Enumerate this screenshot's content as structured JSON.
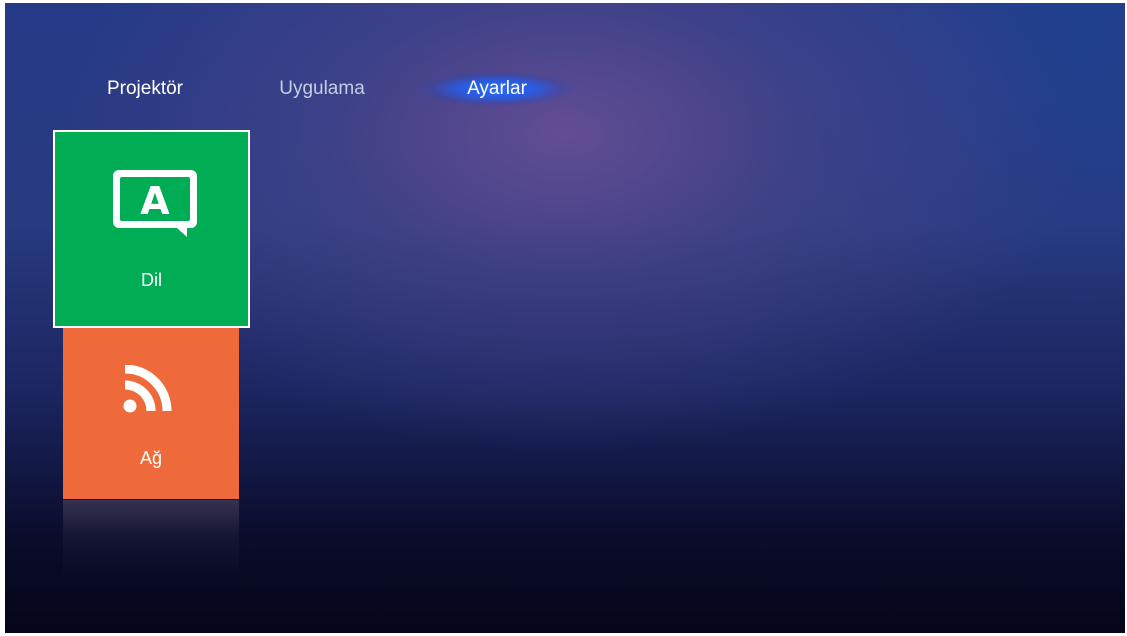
{
  "tabs": [
    {
      "label": "Projektör",
      "active": false
    },
    {
      "label": "Uygulama",
      "active": false
    },
    {
      "label": "Ayarlar",
      "active": true
    }
  ],
  "tiles": [
    {
      "label": "Dil",
      "icon": "language-icon",
      "color": "#00ad55",
      "selected": true
    },
    {
      "label": "Ağ",
      "icon": "network-feed-icon",
      "color": "#ef6a3a",
      "selected": false
    }
  ],
  "icon_glyph": {
    "language_letter": "A"
  },
  "colors": {
    "active_tab_glow": "#2a6cff",
    "background_top": "#243a86",
    "background_bottom": "#05061a"
  }
}
